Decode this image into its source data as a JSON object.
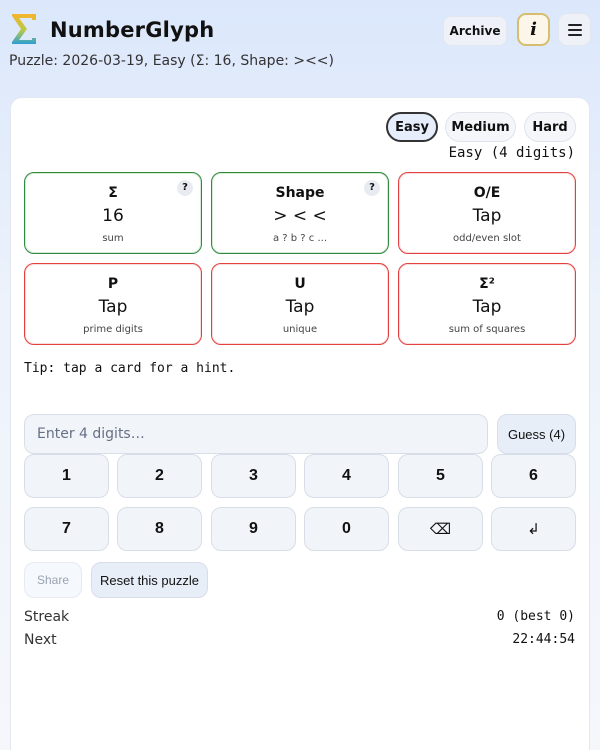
{
  "header": {
    "logo_icon": "sigma-logo-icon",
    "title": "NumberGlyph",
    "archive_label": "Archive",
    "info_label": "i",
    "menu_icon": "hamburger-menu-icon"
  },
  "subtitle": "Puzzle: 2026-03-19, Easy (Σ: 16, Shape: ><<)",
  "difficulty": {
    "options": [
      {
        "label": "Easy",
        "active": true
      },
      {
        "label": "Medium",
        "active": false
      },
      {
        "label": "Hard",
        "active": false
      }
    ],
    "status": "Easy (4 digits)"
  },
  "clues": [
    {
      "title": "Σ",
      "value": "16",
      "desc": "sum",
      "help": "?",
      "state": "solved"
    },
    {
      "title": "Shape",
      "value": "> < <",
      "desc": "a ? b ? c ...",
      "help": "?",
      "state": "solved"
    },
    {
      "title": "O/E",
      "value": "Tap",
      "desc": "odd/even slot",
      "state": "open"
    },
    {
      "title": "P",
      "value": "Tap",
      "desc": "prime digits",
      "state": "open"
    },
    {
      "title": "U",
      "value": "Tap",
      "desc": "unique",
      "state": "open"
    },
    {
      "title": "Σ²",
      "value": "Tap",
      "desc": "sum of squares",
      "state": "open"
    }
  ],
  "tip": "Tip: tap a card for a hint.",
  "guess": {
    "placeholder": "Enter 4 digits…",
    "value": "",
    "button_label": "Guess (4)"
  },
  "keypad": {
    "row1": [
      "1",
      "2",
      "3",
      "4",
      "5",
      "6"
    ],
    "row2": [
      "7",
      "8",
      "9",
      "0",
      "⌫",
      "↲"
    ],
    "backspace_icon": "backspace-icon",
    "enter_icon": "enter-icon"
  },
  "actions": {
    "share_label": "Share",
    "reset_label": "Reset this puzzle"
  },
  "stats": {
    "streak_label": "Streak",
    "streak_value": "0 (best 0)",
    "next_label": "Next",
    "next_value": "22:44:54"
  },
  "colors": {
    "solved_border": "#2f8a3f",
    "open_border": "#e3413f",
    "logo_gradient_top": "#f5b52b",
    "logo_gradient_bottom": "#2a9fd6"
  }
}
